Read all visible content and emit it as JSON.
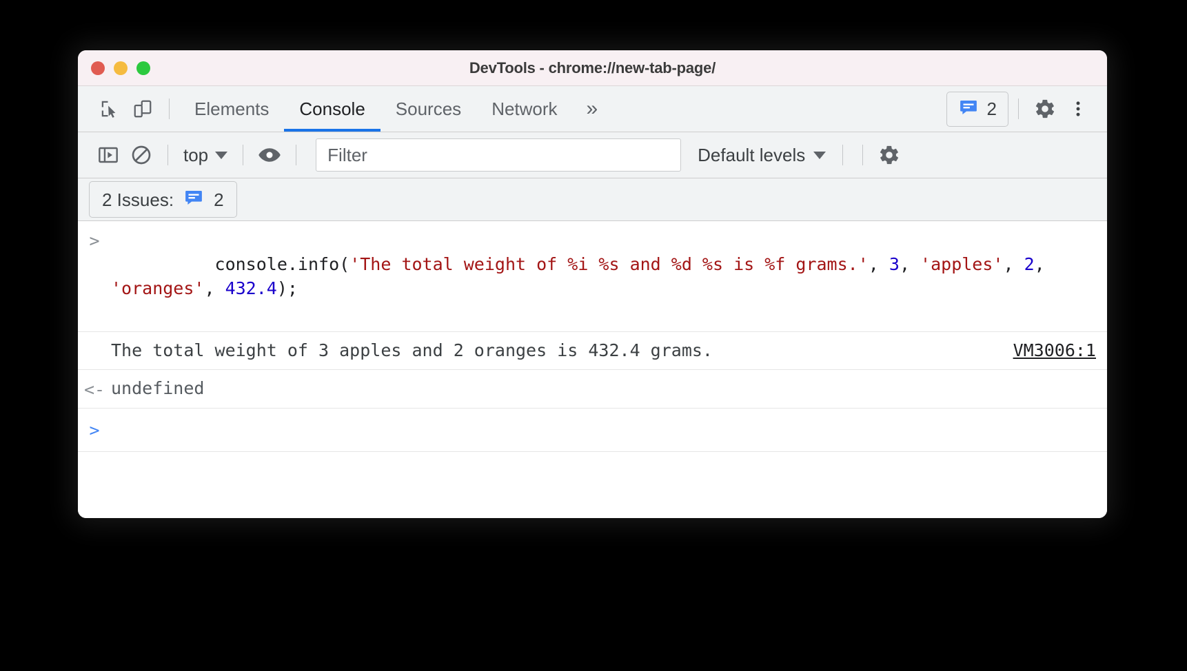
{
  "window": {
    "title": "DevTools - chrome://new-tab-page/",
    "traffic_lights": [
      "close",
      "minimize",
      "zoom"
    ],
    "colors": {
      "close": "#e05c52",
      "minimize": "#f5bb40",
      "zoom": "#2cc93f",
      "accent": "#1a73e8",
      "issue_blue": "#4285f4",
      "string_red": "#a31515",
      "number_blue": "#1a01cc"
    }
  },
  "tabstrip": {
    "inspect_icon": "inspect-cursor-icon",
    "device_icon": "device-toolbar-icon",
    "tabs": [
      {
        "label": "Elements",
        "active": false
      },
      {
        "label": "Console",
        "active": true
      },
      {
        "label": "Sources",
        "active": false
      },
      {
        "label": "Network",
        "active": false
      }
    ],
    "more_tabs_icon": "double-chevron-right-icon",
    "issues_badge": {
      "icon": "issue-message-icon",
      "count": "2"
    },
    "settings_icon": "gear-icon",
    "more_options_icon": "kebab-menu-icon"
  },
  "filterbar": {
    "sidebar_toggle_icon": "console-sidebar-icon",
    "clear_console_icon": "clear-console-icon",
    "context": "top",
    "context_caret_icon": "chevron-down-icon",
    "live_expression_icon": "eye-icon",
    "filter": {
      "value": "",
      "placeholder": "Filter"
    },
    "levels": "Default levels",
    "levels_caret_icon": "chevron-down-icon",
    "settings_icon": "gear-icon"
  },
  "issuesbar": {
    "label": "2 Issues:",
    "icon": "issue-message-icon",
    "count": "2"
  },
  "console": {
    "input_prompt_glyph": ">",
    "output_prompt_glyph": "<-",
    "command": {
      "tokens": [
        {
          "text": "console.info(",
          "type": "plain"
        },
        {
          "text": "'The total weight of %i %s and %d %s is %f grams.'",
          "type": "string"
        },
        {
          "text": ", ",
          "type": "plain"
        },
        {
          "text": "3",
          "type": "number"
        },
        {
          "text": ", ",
          "type": "plain"
        },
        {
          "text": "'apples'",
          "type": "string"
        },
        {
          "text": ", ",
          "type": "plain"
        },
        {
          "text": "2",
          "type": "number"
        },
        {
          "text": ", ",
          "type": "plain"
        },
        {
          "text": "'oranges'",
          "type": "string"
        },
        {
          "text": ", ",
          "type": "plain"
        },
        {
          "text": "432.4",
          "type": "number"
        },
        {
          "text": ");",
          "type": "plain"
        }
      ],
      "plain_text": "console.info('The total weight of %i %s and %d %s is %f grams.', 3, 'apples', 2, 'oranges', 432.4);"
    },
    "log_output": {
      "message": "The total weight of 3 apples and 2 oranges is 432.4 grams.",
      "source_link": "VM3006:1"
    },
    "return_value": "undefined"
  }
}
